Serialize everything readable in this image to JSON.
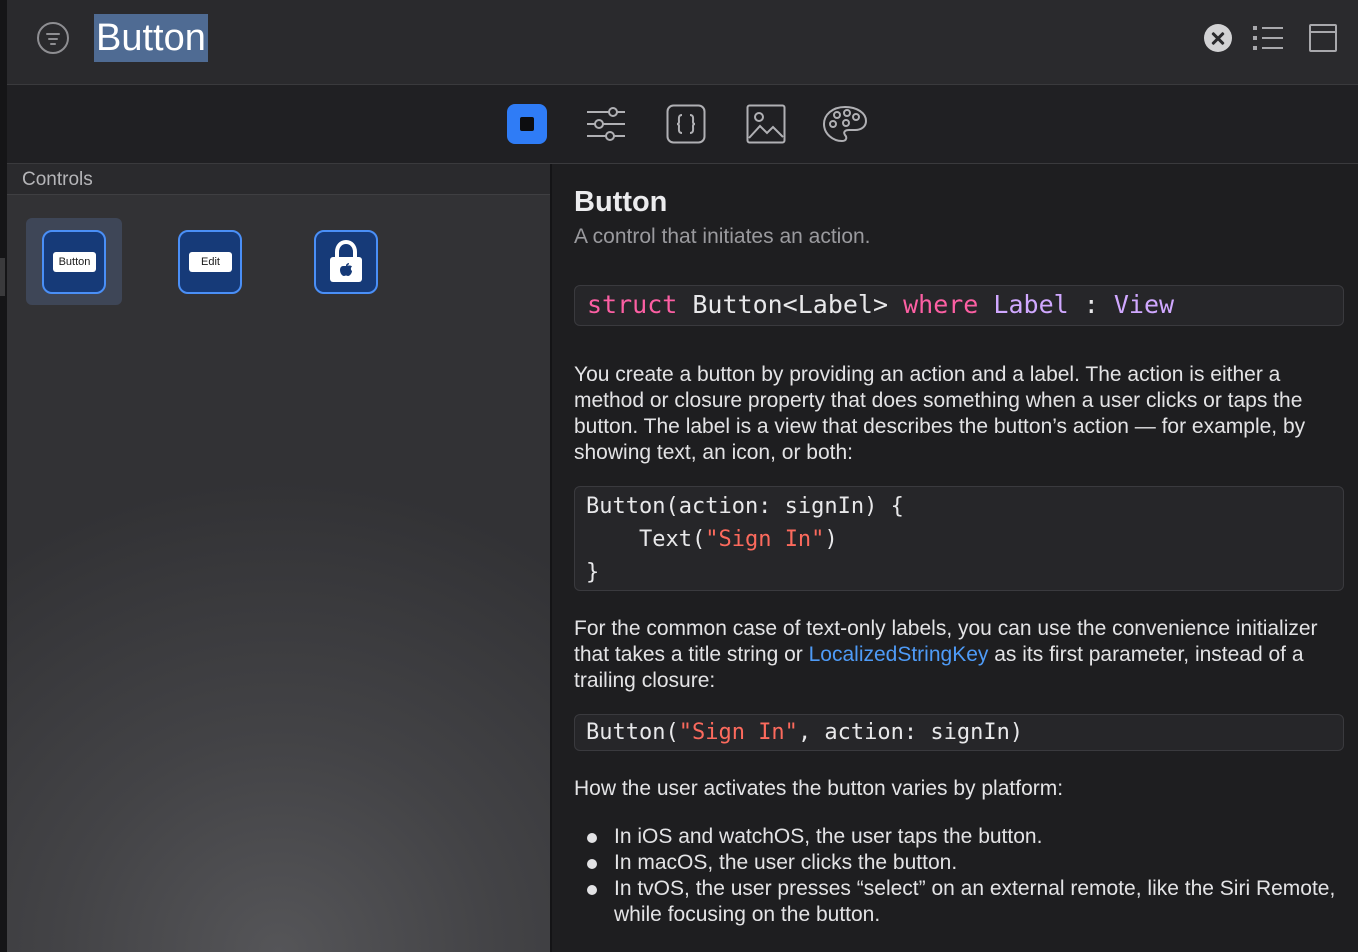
{
  "search": {
    "query": "Button"
  },
  "library": {
    "section_title": "Controls",
    "items": [
      {
        "name": "Button",
        "tile_label": "Button"
      },
      {
        "name": "Edit Button",
        "tile_label": "Edit"
      },
      {
        "name": "Sign In with Apple",
        "icon": "lock-apple-icon"
      }
    ]
  },
  "toolbar": {
    "tabs": [
      "views-icon",
      "modifiers-icon",
      "snippets-icon",
      "media-icon",
      "colors-icon"
    ],
    "active_tab": "views-icon"
  },
  "doc": {
    "title": "Button",
    "subtitle": "A control that initiates an action.",
    "declaration": {
      "struct_kw": "struct",
      "signature": " Button<Label> ",
      "where_kw": "where",
      "label_type": "Label",
      "colon": " : ",
      "view_type": "View"
    },
    "para1": "You create a button by providing an action and a label. The action is either a method or closure property that does something when a user clicks or taps the button. The label is a view that describes the button’s action — for example, by showing text, an icon, or both:",
    "code1": {
      "line1": "Button(action: signIn) {",
      "line2_pre": "    Text(",
      "line2_str": "\"Sign In\"",
      "line2_post": ")",
      "line3": "}"
    },
    "para2_pre": "For the common case of text-only labels, you can use the convenience initializer that takes a title string or ",
    "para2_link": "LocalizedStringKey",
    "para2_post": " as its first parameter, instead of a trailing closure:",
    "code2": {
      "pre": "Button(",
      "str": "\"Sign In\"",
      "post": ", action: signIn)"
    },
    "para3": "How the user activates the button varies by platform:",
    "bullets": [
      "In iOS and watchOS, the user taps the button.",
      "In macOS, the user clicks the button.",
      "In tvOS, the user presses “select” on an external remote, like the Siri Remote, while focusing on the button."
    ]
  },
  "colors": {
    "accent": "#2f7cf6",
    "keyword": "#fc5fa3",
    "type": "#d0a8ff",
    "string": "#fc6a5d",
    "link": "#4e9bf7"
  }
}
